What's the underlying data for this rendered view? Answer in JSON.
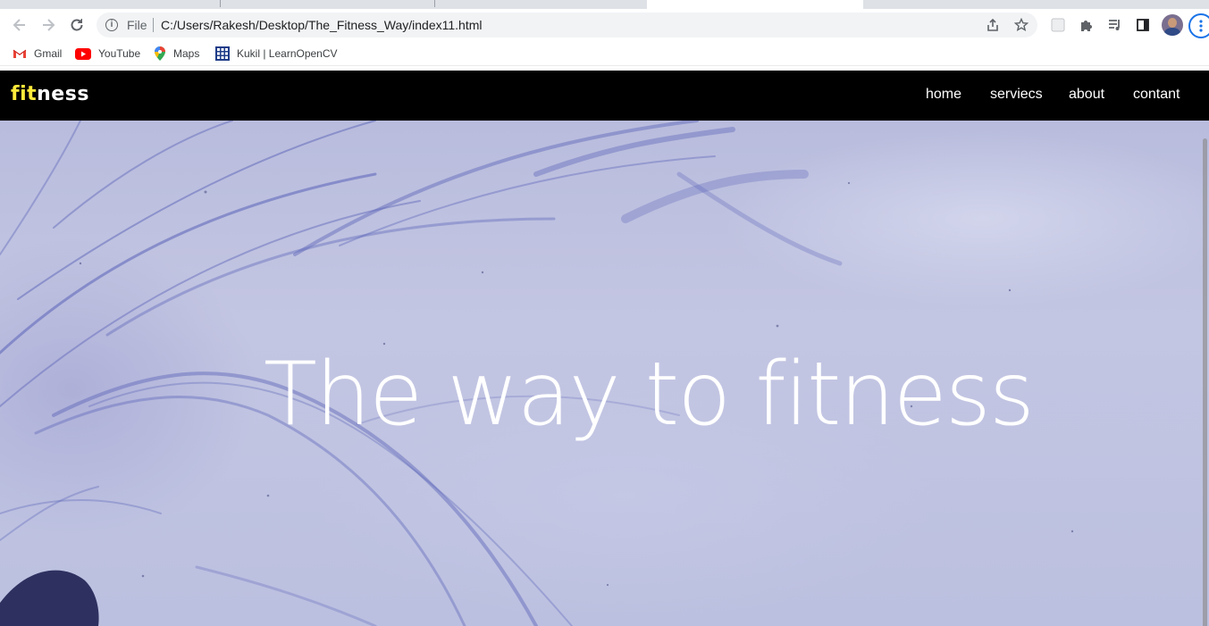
{
  "browser": {
    "scheme_label": "File",
    "url": "C:/Users/Rakesh/Desktop/The_Fitness_Way/index11.html",
    "bookmarks": [
      {
        "label": "Gmail",
        "icon": "gmail-icon"
      },
      {
        "label": "YouTube",
        "icon": "youtube-icon"
      },
      {
        "label": "Maps",
        "icon": "maps-icon"
      },
      {
        "label": "Kukil | LearnOpenCV",
        "icon": "grid-icon"
      }
    ],
    "accent": "#1a73e8"
  },
  "site": {
    "logo": {
      "highlight": "fit",
      "rest": "ness"
    },
    "nav": [
      "home",
      "serviecs",
      "about",
      "contant"
    ],
    "hero_title": "The way to fitness",
    "colors": {
      "nav_bg": "#000000",
      "logo_highlight": "#ffeb3b",
      "hero_bg": "#bcc0e0"
    }
  }
}
